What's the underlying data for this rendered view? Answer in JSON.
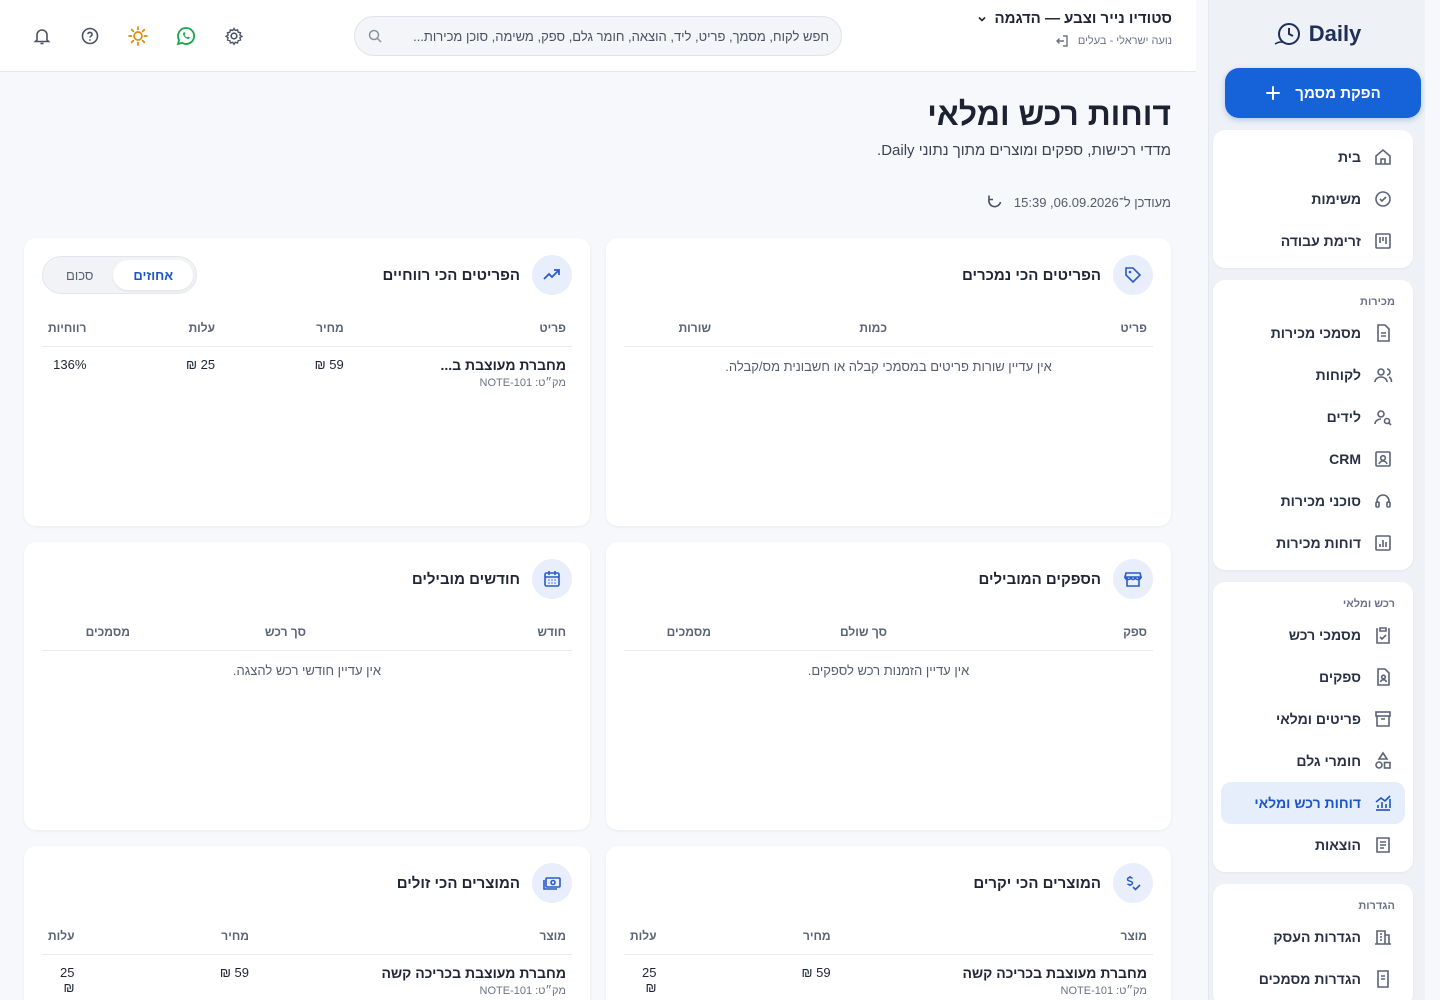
{
  "sidebar": {
    "logo_text": "Daily",
    "new_doc_label": "הפקת מסמך",
    "home_group": [
      {
        "label": "בית",
        "icon": "home-icon"
      },
      {
        "label": "משימות",
        "icon": "check-circle-icon"
      },
      {
        "label": "זרימת עבודה",
        "icon": "kanban-icon"
      }
    ],
    "sales_title": "מכירות",
    "sales": [
      {
        "label": "מסמכי מכירות",
        "icon": "file-icon"
      },
      {
        "label": "לקוחות",
        "icon": "users-icon"
      },
      {
        "label": "לידים",
        "icon": "user-search-icon"
      },
      {
        "label": "CRM",
        "icon": "contact-card-icon"
      },
      {
        "label": "סוכני מכירות",
        "icon": "headset-icon"
      },
      {
        "label": "דוחות מכירות",
        "icon": "bar-chart-icon"
      }
    ],
    "purchase_title": "רכש ומלאי",
    "purchase": [
      {
        "label": "מסמכי רכש",
        "icon": "clipboard-check-icon"
      },
      {
        "label": "ספקים",
        "icon": "file-user-icon"
      },
      {
        "label": "פריטים ומלאי",
        "icon": "archive-icon"
      },
      {
        "label": "חומרי גלם",
        "icon": "shapes-icon"
      },
      {
        "label": "דוחות רכש ומלאי",
        "icon": "chart-trend-icon",
        "active": true
      },
      {
        "label": "הוצאות",
        "icon": "receipt-icon"
      }
    ],
    "settings_title": "הגדרות",
    "settings": [
      {
        "label": "הגדרות העסק",
        "icon": "building-icon"
      },
      {
        "label": "הגדרות מסמכים",
        "icon": "doc-settings-icon"
      }
    ]
  },
  "topbar": {
    "business_name": "סטודיו נייר וצבע — הדגמה",
    "user_line": "נועה ישראלי - בעלים",
    "search_placeholder": "חפש לקוח, מסמך, פריט, ליד, הוצאה, חומר גלם, ספק, משימה, סוכן מכירות..."
  },
  "page": {
    "title": "דוחות רכש ומלאי",
    "subtitle": "מדדי רכישות, ספקים ומוצרים מתוך נתוני Daily.",
    "updated": "מעודכן ל־06.09.2026, 15:39"
  },
  "cards": {
    "top_sold": {
      "title": "הפריטים הכי נמכרים",
      "cols": [
        "פריט",
        "כמות",
        "שורות"
      ],
      "empty": "אין עדיין שורות פריטים במסמכי קבלה או חשבונית מס/קבלה."
    },
    "top_profit": {
      "title": "הפריטים הכי רווחיים",
      "toggle_on": "אחוזים",
      "toggle_off": "סכום",
      "cols": [
        "פריט",
        "מחיר",
        "עלות",
        "רווחיות"
      ],
      "rows": [
        {
          "name": "מחברת מעוצבת ב...",
          "sku": "מק״ט: NOTE-101",
          "price": "59 ₪",
          "cost": "25 ₪",
          "margin": "136%"
        }
      ]
    },
    "top_suppliers": {
      "title": "הספקים המובילים",
      "cols": [
        "ספק",
        "סך שולם",
        "מסמכים"
      ],
      "empty": "אין עדיין הזמנות רכש לספקים."
    },
    "top_months": {
      "title": "חודשים מובילים",
      "cols": [
        "חודש",
        "סך רכש",
        "מסמכים"
      ],
      "empty": "אין עדיין חודשי רכש להצגה."
    },
    "expensive": {
      "title": "המוצרים הכי יקרים",
      "cols": [
        "מוצר",
        "מחיר",
        "עלות"
      ],
      "rows": [
        {
          "name": "מחברת מעוצבת בכריכה קשה",
          "sku": "מק״ט: NOTE-101",
          "price": "59 ₪",
          "cost": "25 ₪"
        }
      ]
    },
    "cheap": {
      "title": "המוצרים הכי זולים",
      "cols": [
        "מוצר",
        "מחיר",
        "עלות"
      ],
      "rows": [
        {
          "name": "מחברת מעוצבת בכריכה קשה",
          "sku": "מק״ט: NOTE-101",
          "price": "59 ₪",
          "cost": "25 ₪"
        }
      ]
    }
  }
}
